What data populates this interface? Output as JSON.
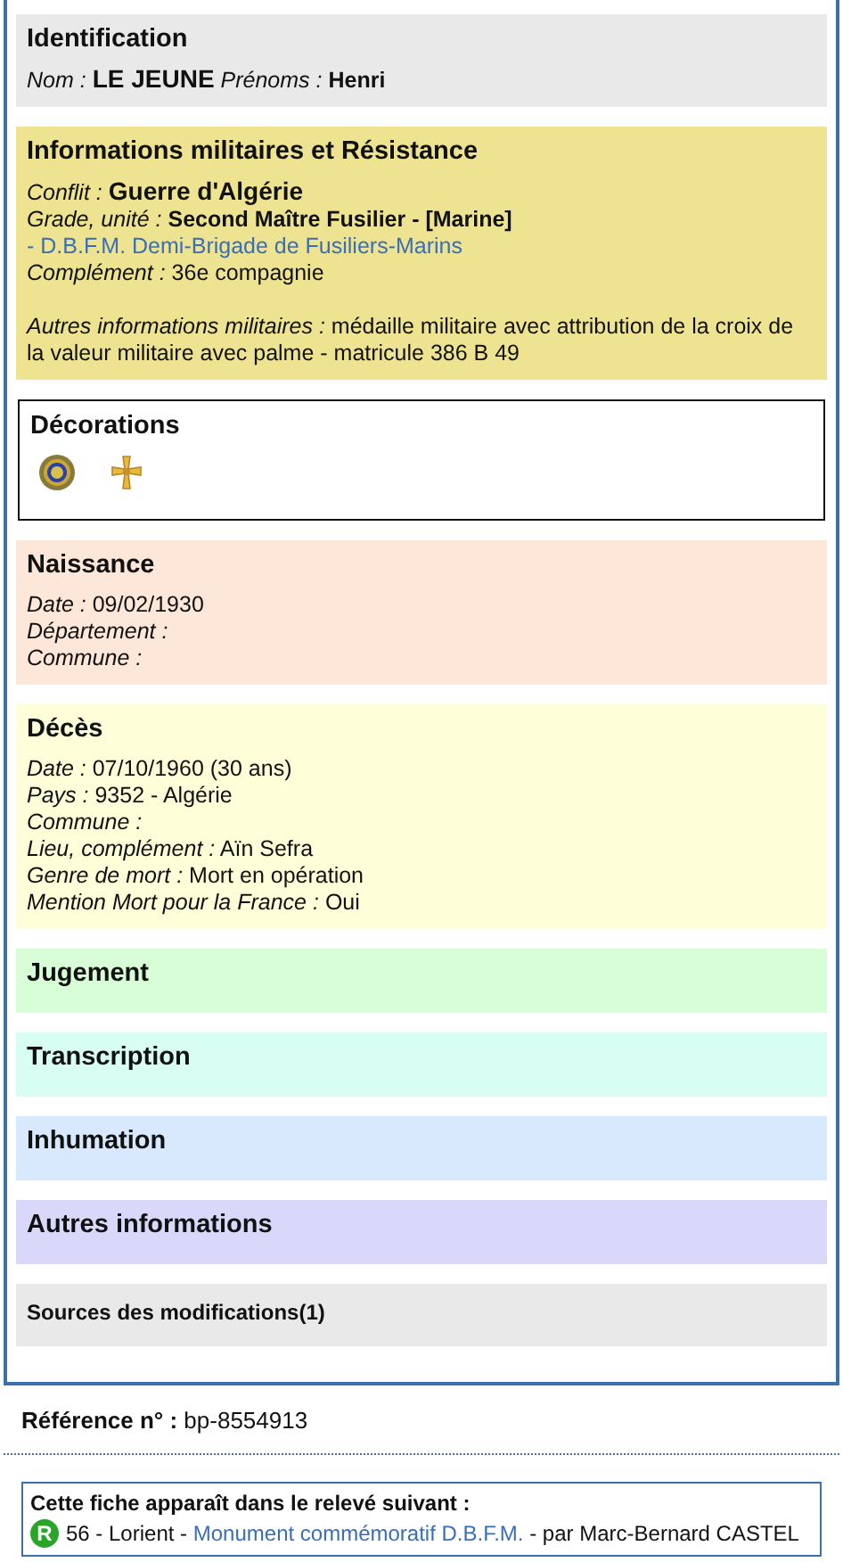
{
  "sections": [
    {
      "kind": "info",
      "title": "Identification",
      "color": "#e9e9e9",
      "groups": [
        {
          "lines": [
            {
              "parts": [
                {
                  "kind": "label",
                  "text": "Nom :"
                },
                {
                  "kind": "big",
                  "text": "LE JEUNE"
                },
                {
                  "kind": "label",
                  "text": "Prénoms :"
                },
                {
                  "kind": "bold",
                  "text": "Henri"
                }
              ]
            }
          ]
        }
      ]
    },
    {
      "kind": "info",
      "title": "Informations militaires et Résistance",
      "color": "#ede390",
      "groups": [
        {
          "lines": [
            {
              "parts": [
                {
                  "kind": "label",
                  "text": "Conflit :"
                },
                {
                  "kind": "big",
                  "text": "Guerre d'Algérie"
                }
              ]
            },
            {
              "parts": [
                {
                  "kind": "label",
                  "text": "Grade, unité :"
                },
                {
                  "kind": "bold",
                  "text": "Second Maître Fusilier - [Marine]"
                },
                {
                  "kind": "link",
                  "text": "- D.B.F.M. Demi-Brigade de Fusiliers-Marins"
                }
              ]
            },
            {
              "parts": [
                {
                  "kind": "label",
                  "text": "Complément :"
                },
                {
                  "kind": "plain",
                  "text": "36e compagnie"
                }
              ]
            }
          ]
        },
        {
          "lines": [
            {
              "parts": [
                {
                  "kind": "label",
                  "text": "Autres informations militaires :"
                },
                {
                  "kind": "plain",
                  "text": "médaille militaire avec attribution de la croix de la valeur militaire avec palme - matricule 386 B 49"
                }
              ]
            }
          ]
        }
      ]
    },
    {
      "kind": "decorations",
      "title": "Décorations",
      "color": "#ffffff",
      "medals": [
        {
          "kind": "medal"
        },
        {
          "kind": "cross"
        }
      ]
    },
    {
      "kind": "info",
      "title": "Naissance",
      "color": "#fde7d9",
      "groups": [
        {
          "lines": [
            {
              "parts": [
                {
                  "kind": "label",
                  "text": "Date :"
                },
                {
                  "kind": "plain",
                  "text": "09/02/1930"
                }
              ]
            },
            {
              "parts": [
                {
                  "kind": "label",
                  "text": "Département :"
                }
              ]
            },
            {
              "parts": [
                {
                  "kind": "label",
                  "text": "Commune :"
                }
              ]
            }
          ]
        }
      ]
    },
    {
      "kind": "info",
      "title": "Décès",
      "color": "#fefed9",
      "groups": [
        {
          "lines": [
            {
              "parts": [
                {
                  "kind": "label",
                  "text": "Date :"
                },
                {
                  "kind": "plain",
                  "text": "07/10/1960  (30 ans)"
                }
              ]
            },
            {
              "parts": [
                {
                  "kind": "label",
                  "text": "Pays :"
                },
                {
                  "kind": "plain",
                  "text": "9352 - Algérie"
                }
              ]
            },
            {
              "parts": [
                {
                  "kind": "label",
                  "text": "Commune :"
                }
              ]
            },
            {
              "parts": [
                {
                  "kind": "label",
                  "text": "Lieu, complément :"
                },
                {
                  "kind": "plain",
                  "text": "Aïn Sefra"
                }
              ]
            },
            {
              "parts": [
                {
                  "kind": "label",
                  "text": "Genre de mort :"
                },
                {
                  "kind": "plain",
                  "text": "Mort en opération"
                }
              ]
            },
            {
              "parts": [
                {
                  "kind": "label",
                  "text": "Mention Mort pour la France :"
                },
                {
                  "kind": "plain",
                  "text": "Oui"
                }
              ]
            }
          ]
        }
      ]
    },
    {
      "kind": "info",
      "title": "Jugement",
      "color": "#d8fed8"
    },
    {
      "kind": "info",
      "title": "Transcription",
      "color": "#d8fef4"
    },
    {
      "kind": "info",
      "title": "Inhumation",
      "color": "#d8e9fd"
    },
    {
      "kind": "info",
      "title": "Autres informations",
      "color": "#d9d8fa"
    },
    {
      "kind": "sources",
      "title": "Sources des modifications(1)",
      "color": "#e9e9e9"
    }
  ],
  "reference": {
    "label": "Référence n° :",
    "value": "bp-8554913"
  },
  "listing": {
    "title": "Cette fiche apparaît dans le relevé suivant :",
    "badge": "R",
    "prefix": "56 - Lorient -",
    "link": "Monument commémoratif D.B.F.M.",
    "suffix": "- par Marc-Bernard CASTEL"
  }
}
